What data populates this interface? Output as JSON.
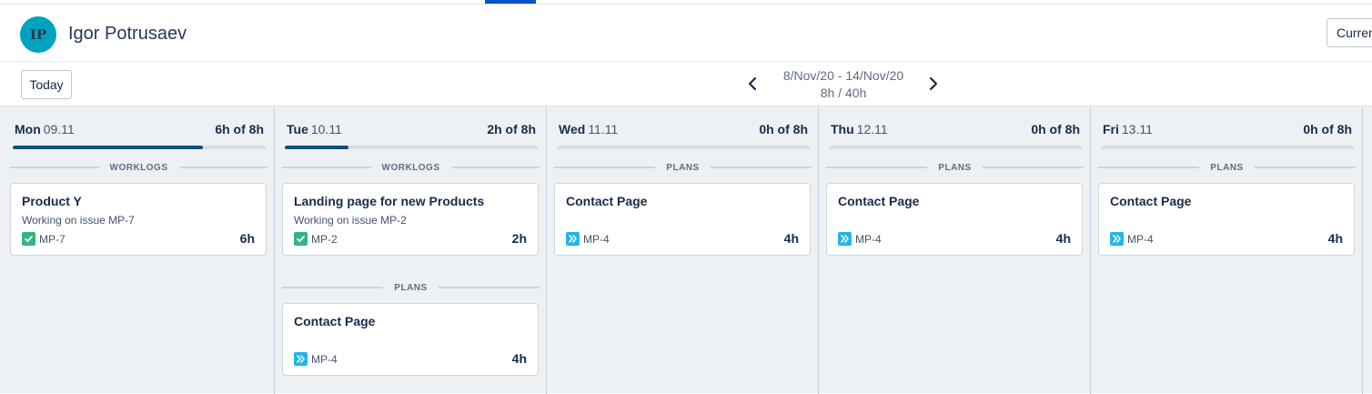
{
  "user": {
    "initials": "IP",
    "name": "Igor Potrusaev"
  },
  "header": {
    "current_label": "Curren"
  },
  "toolbar": {
    "today_label": "Today",
    "date_range": "8/Nov/20 - 14/Nov/20",
    "total_hours": "8h / 40h"
  },
  "colors": {
    "accent": "#0052cc",
    "avatar": "#00a3bf",
    "progress": "#0b4f7a",
    "done_icon": "#36b37e",
    "plan_icon": "#1fb7e8"
  },
  "days": [
    {
      "name": "Mon",
      "date": "09.11",
      "total": "6h of 8h",
      "progress_fraction": 0.75,
      "sections": [
        {
          "label": "WORKLOGS",
          "cards": [
            {
              "title": "Product Y",
              "description": "Working on issue MP-7",
              "issue": "MP-7",
              "issue_icon": "check-icon",
              "hours": "6h"
            }
          ]
        }
      ]
    },
    {
      "name": "Tue",
      "date": "10.11",
      "total": "2h of 8h",
      "progress_fraction": 0.25,
      "sections": [
        {
          "label": "WORKLOGS",
          "cards": [
            {
              "title": "Landing page for new Products",
              "description": "Working on issue MP-2",
              "issue": "MP-2",
              "issue_icon": "check-icon",
              "hours": "2h"
            }
          ]
        },
        {
          "label": "PLANS",
          "cards": [
            {
              "title": "Contact Page",
              "description": "",
              "issue": "MP-4",
              "issue_icon": "double-chevron-icon",
              "hours": "4h"
            }
          ]
        }
      ]
    },
    {
      "name": "Wed",
      "date": "11.11",
      "total": "0h of 8h",
      "progress_fraction": 0,
      "sections": [
        {
          "label": "PLANS",
          "cards": [
            {
              "title": "Contact Page",
              "description": "",
              "issue": "MP-4",
              "issue_icon": "double-chevron-icon",
              "hours": "4h"
            }
          ]
        }
      ]
    },
    {
      "name": "Thu",
      "date": "12.11",
      "total": "0h of 8h",
      "progress_fraction": 0,
      "sections": [
        {
          "label": "PLANS",
          "cards": [
            {
              "title": "Contact Page",
              "description": "",
              "issue": "MP-4",
              "issue_icon": "double-chevron-icon",
              "hours": "4h"
            }
          ]
        }
      ]
    },
    {
      "name": "Fri",
      "date": "13.11",
      "total": "0h of 8h",
      "progress_fraction": 0,
      "sections": [
        {
          "label": "PLANS",
          "cards": [
            {
              "title": "Contact Page",
              "description": "",
              "issue": "MP-4",
              "issue_icon": "double-chevron-icon",
              "hours": "4h"
            }
          ]
        }
      ]
    }
  ]
}
